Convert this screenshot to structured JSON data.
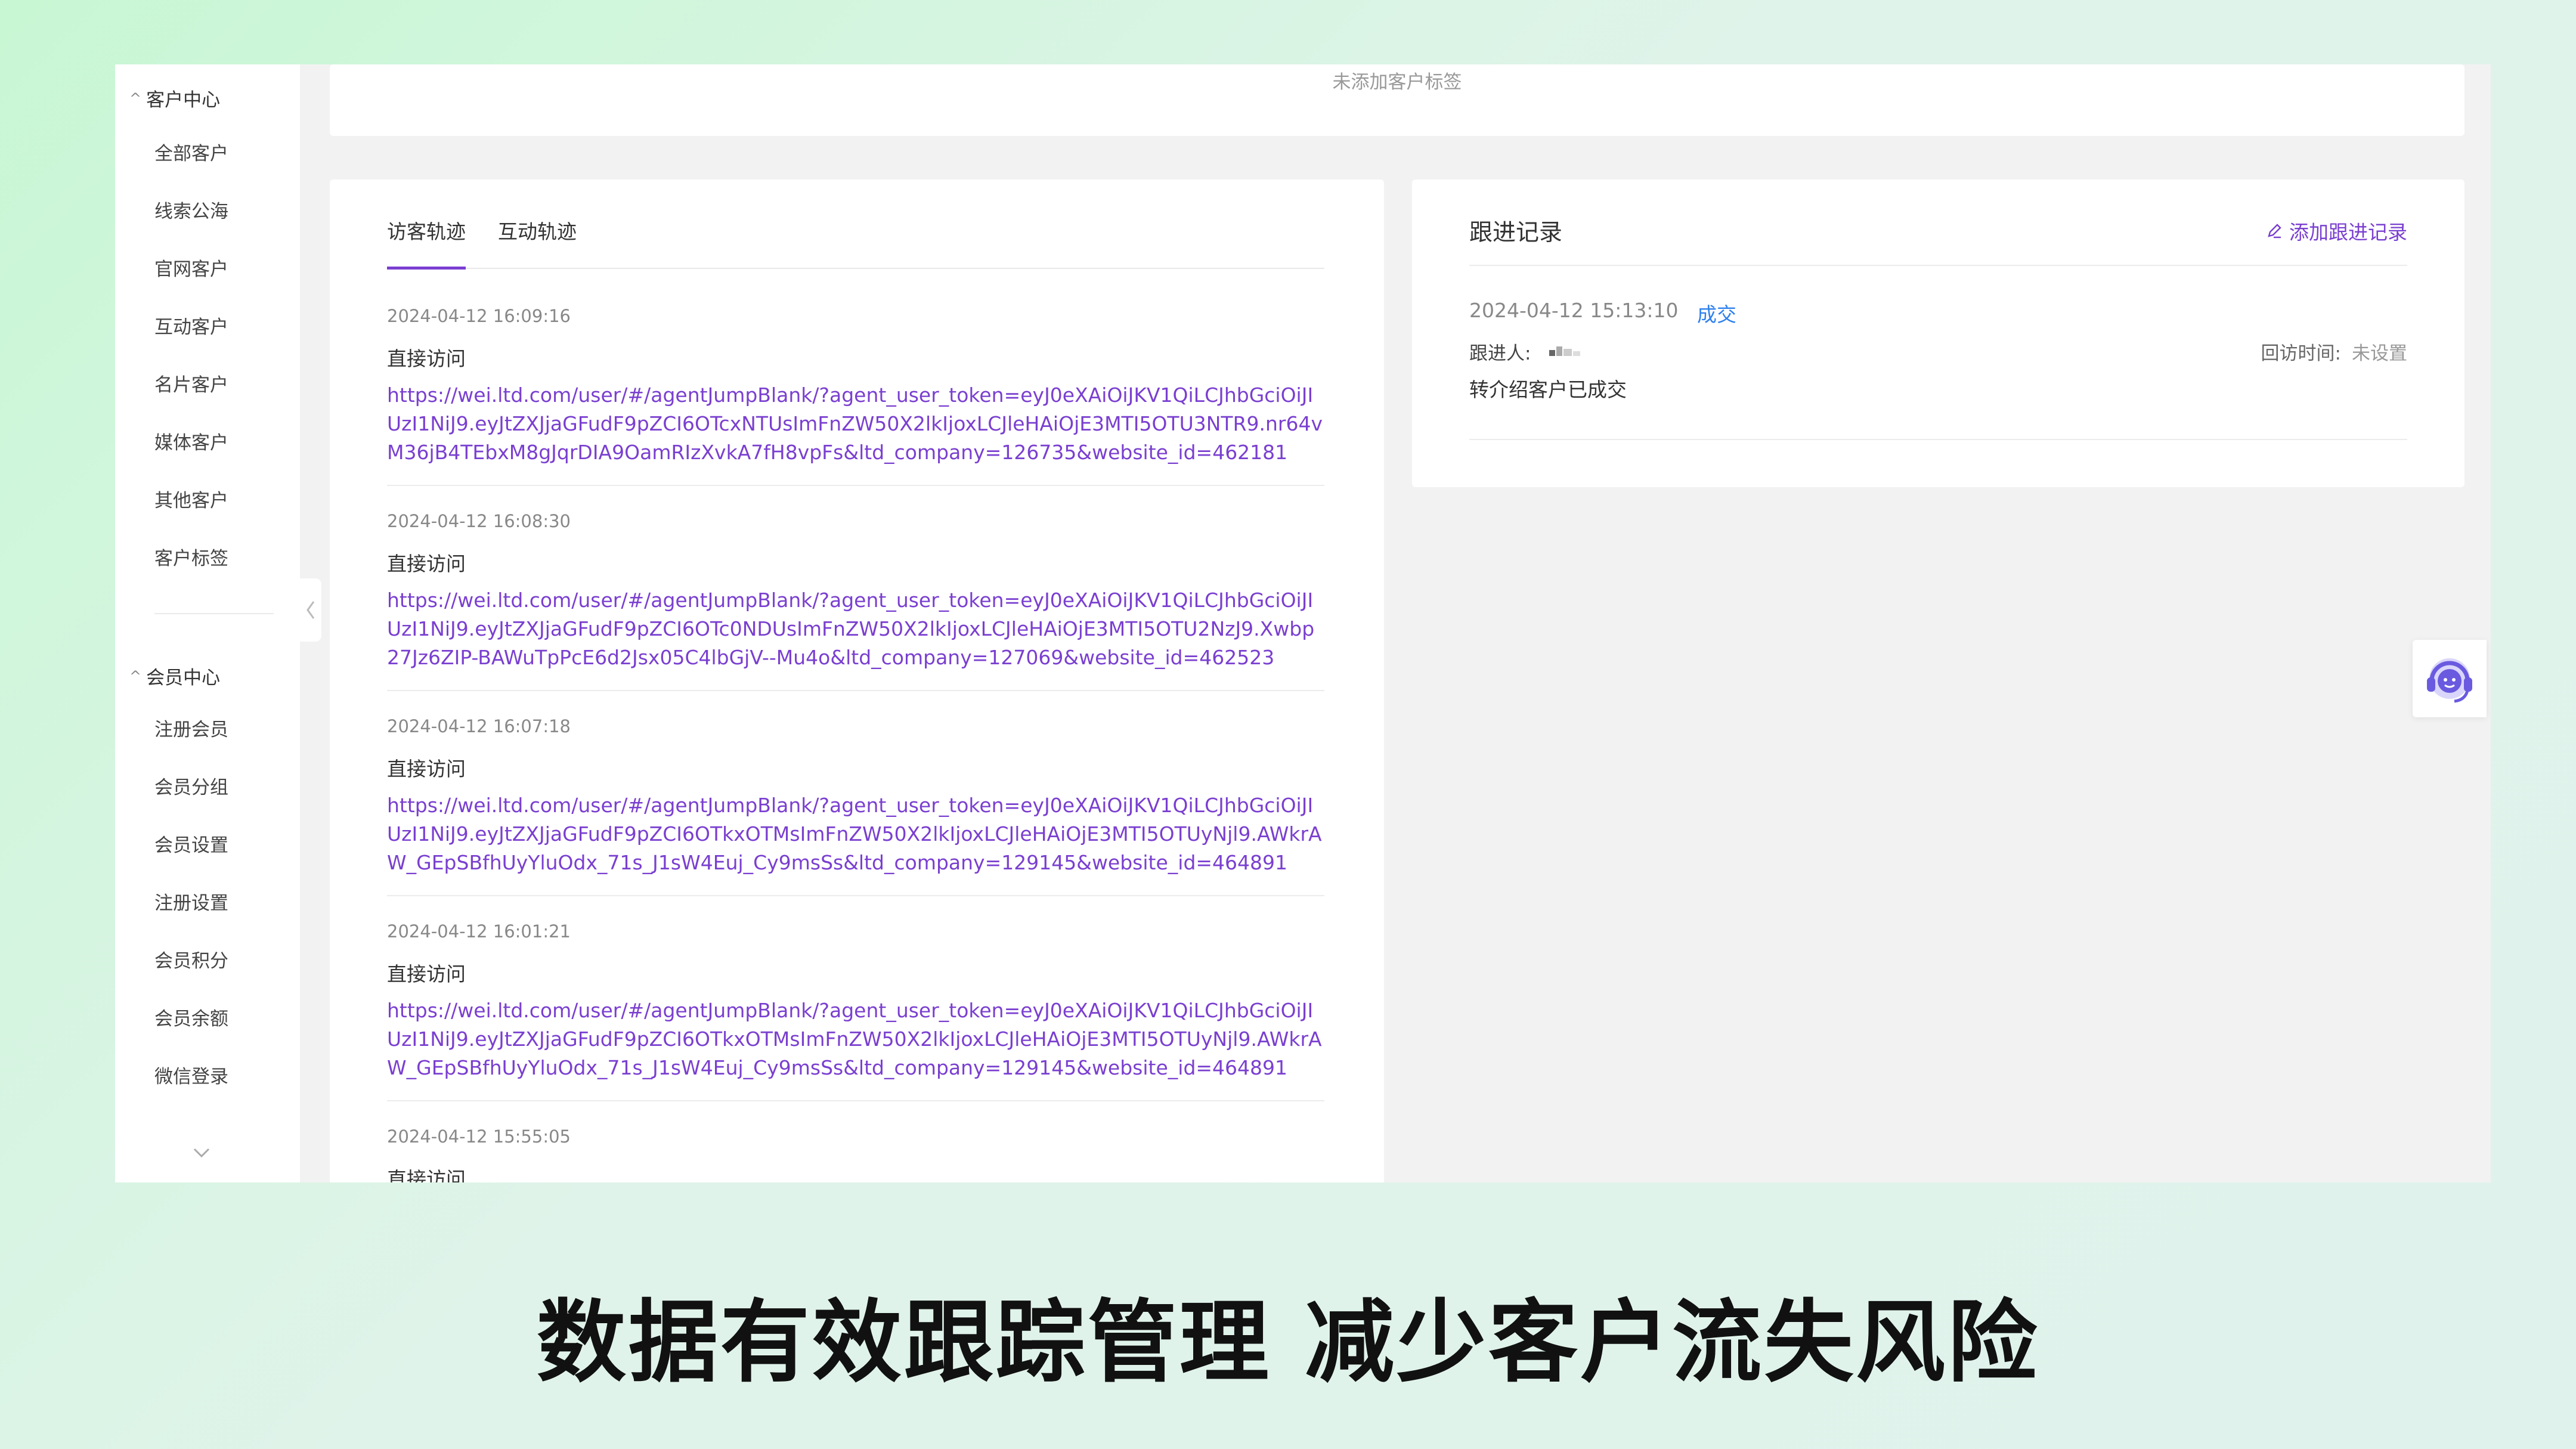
{
  "sidebar": {
    "customer_center": {
      "title": "客户中心",
      "items": [
        "全部客户",
        "线索公海",
        "官网客户",
        "互动客户",
        "名片客户",
        "媒体客户",
        "其他客户",
        "客户标签"
      ]
    },
    "member_center": {
      "title": "会员中心",
      "items": [
        "注册会员",
        "会员分组",
        "会员设置",
        "注册设置",
        "会员积分",
        "会员余额",
        "微信登录"
      ]
    }
  },
  "top_card": {
    "empty_tags": "未添加客户标签"
  },
  "visitor_panel": {
    "tabs": [
      "访客轨迹",
      "互动轨迹"
    ],
    "active_tab": 0,
    "entries": [
      {
        "time": "2024-04-12 16:09:16",
        "type": "直接访问",
        "url": "https://wei.ltd.com/user/#/agentJumpBlank/?agent_user_token=eyJ0eXAiOiJKV1QiLCJhbGciOiJIUzI1NiJ9.eyJtZXJjaGFudF9pZCI6OTcxNTUsImFnZW50X2lkIjoxLCJleHAiOjE3MTI5OTU3NTR9.nr64vM36jB4TEbxM8gJqrDIA9OamRIzXvkA7fH8vpFs&ltd_company=126735&website_id=462181"
      },
      {
        "time": "2024-04-12 16:08:30",
        "type": "直接访问",
        "url": "https://wei.ltd.com/user/#/agentJumpBlank/?agent_user_token=eyJ0eXAiOiJKV1QiLCJhbGciOiJIUzI1NiJ9.eyJtZXJjaGFudF9pZCI6OTc0NDUsImFnZW50X2lkIjoxLCJleHAiOjE3MTI5OTU2NzJ9.Xwbp27Jz6ZIP-BAWuTpPcE6d2Jsx05C4lbGjV--Mu4o&ltd_company=127069&website_id=462523"
      },
      {
        "time": "2024-04-12 16:07:18",
        "type": "直接访问",
        "url": "https://wei.ltd.com/user/#/agentJumpBlank/?agent_user_token=eyJ0eXAiOiJKV1QiLCJhbGciOiJIUzI1NiJ9.eyJtZXJjaGFudF9pZCI6OTkxOTMsImFnZW50X2lkIjoxLCJleHAiOjE3MTI5OTUyNjl9.AWkrAW_GEpSBfhUyYluOdx_71s_J1sW4Euj_Cy9msSs&ltd_company=129145&website_id=464891"
      },
      {
        "time": "2024-04-12 16:01:21",
        "type": "直接访问",
        "url": "https://wei.ltd.com/user/#/agentJumpBlank/?agent_user_token=eyJ0eXAiOiJKV1QiLCJhbGciOiJIUzI1NiJ9.eyJtZXJjaGFudF9pZCI6OTkxOTMsImFnZW50X2lkIjoxLCJleHAiOjE3MTI5OTUyNjl9.AWkrAW_GEpSBfhUyYluOdx_71s_J1sW4Euj_Cy9msSs&ltd_company=129145&website_id=464891"
      },
      {
        "time": "2024-04-12 15:55:05",
        "type": "直接访问",
        "url": ""
      }
    ]
  },
  "follow_panel": {
    "title": "跟进记录",
    "add_label": "添加跟进记录",
    "record": {
      "time": "2024-04-12 15:13:10",
      "status": "成交",
      "follower_label": "跟进人:",
      "revisit_label": "回访时间:",
      "revisit_value": "未设置",
      "note": "转介绍客户已成交"
    }
  },
  "caption": "数据有效跟踪管理 减少客户流失风险",
  "colors": {
    "accent": "#7a3fd0",
    "status_blue": "#2f80ed",
    "support_icon": "#7b6cf0"
  }
}
